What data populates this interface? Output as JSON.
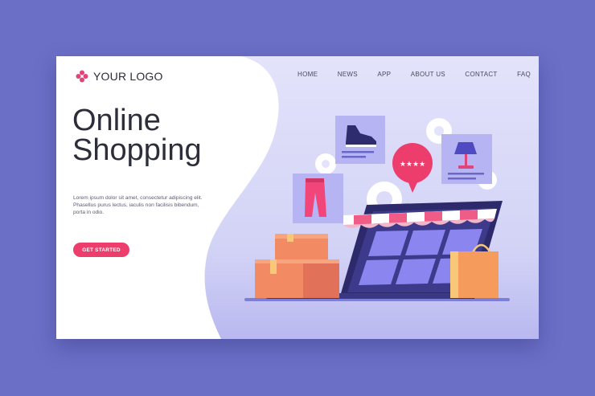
{
  "logo": {
    "text": "YOUR LOGO",
    "icon": "flower-logo-icon"
  },
  "nav": [
    "HOME",
    "NEWS",
    "APP",
    "ABOUT US",
    "CONTACT",
    "FAQ"
  ],
  "hero": {
    "title_line1": "Online",
    "title_line2": "Shopping",
    "description_lines": [
      "Lorem ipsum dolor sit amet, consectetur adipiscing elit.",
      "Phasellus purus lectus, iaculis non facilisis bibendum,",
      "porta in odio."
    ],
    "cta": "GET STARTED"
  },
  "illustration": {
    "icons": [
      "sneaker-icon",
      "pants-icon",
      "lamp-icon",
      "rating-bubble-icon",
      "laptop-icon",
      "boxes-icon",
      "shopping-bag-icon",
      "awning-icon"
    ],
    "rating_stars": "★★★★"
  },
  "colors": {
    "background": "#6b6fc6",
    "accent": "#ec3d6d",
    "card": "#e3e3fb",
    "text": "#2e2e3a"
  }
}
